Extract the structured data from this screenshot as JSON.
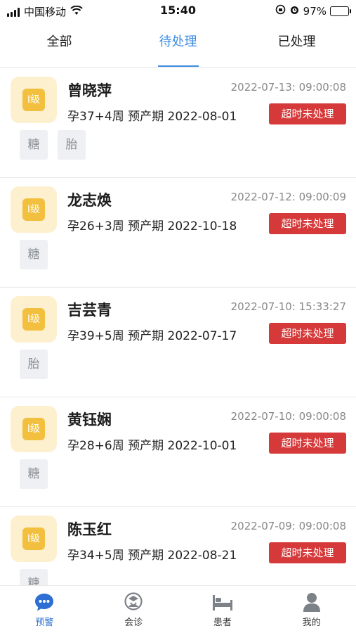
{
  "status_bar": {
    "carrier": "中国移动",
    "time": "15:40",
    "battery": "97%",
    "icons": [
      "signal-icon",
      "wifi-icon",
      "lock-rotation-icon",
      "alarm-icon",
      "battery-icon"
    ]
  },
  "tabs": [
    {
      "label": "全部"
    },
    {
      "label": "待处理"
    },
    {
      "label": "已处理"
    }
  ],
  "records": [
    {
      "level": "I级",
      "name": "曾晓萍",
      "time": "2022-07-13: 09:00:08",
      "info": "孕37+4周 预产期 2022-08-01",
      "status": "超时未处理",
      "tags": [
        "糖",
        "胎"
      ]
    },
    {
      "level": "I级",
      "name": "龙志焕",
      "time": "2022-07-12: 09:00:09",
      "info": "孕26+3周 预产期 2022-10-18",
      "status": "超时未处理",
      "tags": [
        "糖"
      ]
    },
    {
      "level": "I级",
      "name": "吉芸青",
      "time": "2022-07-10: 15:33:27",
      "info": "孕39+5周 预产期 2022-07-17",
      "status": "超时未处理",
      "tags": [
        "胎"
      ]
    },
    {
      "level": "I级",
      "name": "黄钰娴",
      "time": "2022-07-10: 09:00:08",
      "info": "孕28+6周 预产期 2022-10-01",
      "status": "超时未处理",
      "tags": [
        "糖"
      ]
    },
    {
      "level": "I级",
      "name": "陈玉红",
      "time": "2022-07-09: 09:00:08",
      "info": "孕34+5周 预产期 2022-08-21",
      "status": "超时未处理",
      "tags": [
        "糖"
      ]
    }
  ],
  "bottom_nav": [
    {
      "label": "预警",
      "icon": "chat-bubble-icon"
    },
    {
      "label": "会诊",
      "icon": "doctor-icon"
    },
    {
      "label": "患者",
      "icon": "bed-icon"
    },
    {
      "label": "我的",
      "icon": "person-icon"
    }
  ],
  "colors": {
    "accent": "#3f8ee0",
    "nav_active": "#2d6fd2",
    "status_badge": "#d53939",
    "level_bg": "#fdf0cf",
    "level_inner": "#f2c03e"
  }
}
